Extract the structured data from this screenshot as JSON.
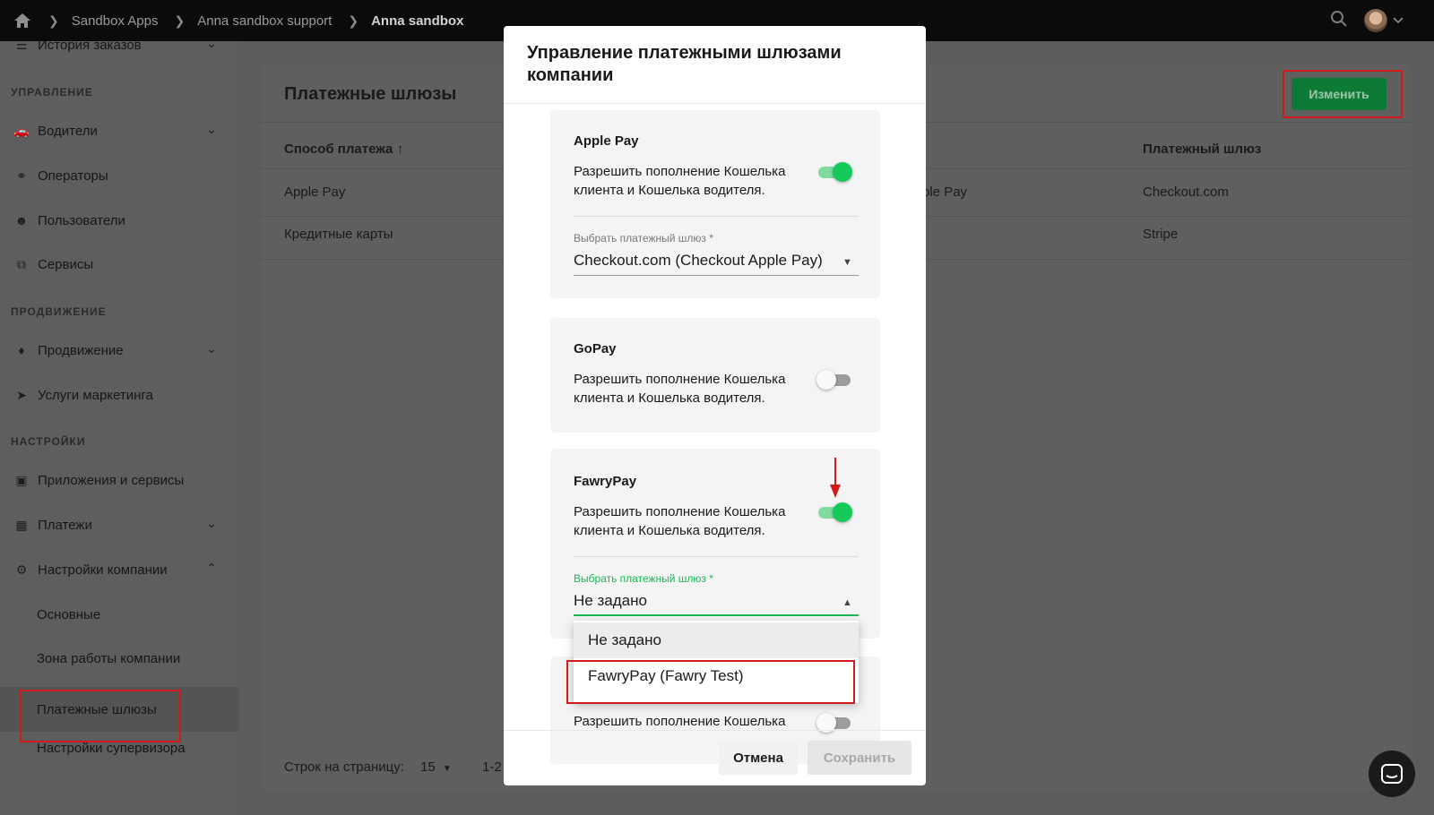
{
  "breadcrumb": [
    "Sandbox Apps",
    "Anna sandbox support",
    "Anna sandbox"
  ],
  "sidebar": {
    "partial_top": "История заказов",
    "sections": {
      "management": "УПРАВЛЕНИЕ",
      "promotion": "ПРОДВИЖЕНИЕ",
      "settings": "НАСТРОЙКИ"
    },
    "items": {
      "drivers": "Водители",
      "operators": "Операторы",
      "users": "Пользователи",
      "services": "Сервисы",
      "promotion": "Продвижение",
      "marketing": "Услуги маркетинга",
      "apps": "Приложения и сервисы",
      "payments": "Платежи",
      "company_settings": "Настройки компании",
      "basic": "Основные",
      "zone": "Зона работы компании",
      "gateways": "Платежные шлюзы",
      "supervisor": "Настройки супервизора"
    }
  },
  "main": {
    "title": "Платежные шлюзы",
    "edit_label": "Изменить",
    "columns": {
      "method": "Способ платежа",
      "gateway": "Платежный шлюз"
    },
    "rows": [
      {
        "method": "Apple Pay",
        "middle": "ple Pay",
        "gateway": "Checkout.com"
      },
      {
        "method": "Кредитные карты",
        "gateway": "Stripe"
      }
    ],
    "pager": {
      "label": "Строк на страницу:",
      "value": "15",
      "range": "1-2"
    }
  },
  "modal": {
    "title": "Управление платежными шлюзами компании",
    "cards": [
      {
        "name": "Apple Pay",
        "desc": "Разрешить пополнение Кошелька клиента и Кошелька водителя.",
        "enabled": true,
        "field_label": "Выбрать платежный шлюз *",
        "field_value": "Checkout.com (Checkout Apple Pay)"
      },
      {
        "name": "GoPay",
        "desc": "Разрешить пополнение Кошелька клиента и Кошелька водителя.",
        "enabled": false
      },
      {
        "name": "FawryPay",
        "desc": "Разрешить пополнение Кошелька клиента и Кошелька водителя.",
        "enabled": true,
        "field_label": "Выбрать платежный шлюз *",
        "field_value": "Не задано"
      },
      {
        "desc": "Разрешить пополнение Кошелька",
        "enabled": false
      }
    ],
    "dropdown_options": [
      "Не задано",
      "FawryPay (Fawry Test)"
    ],
    "cancel_label": "Отмена",
    "save_label": "Сохранить"
  },
  "colors": {
    "accent_green": "#16c95b",
    "highlight_red": "#d21a1a"
  }
}
